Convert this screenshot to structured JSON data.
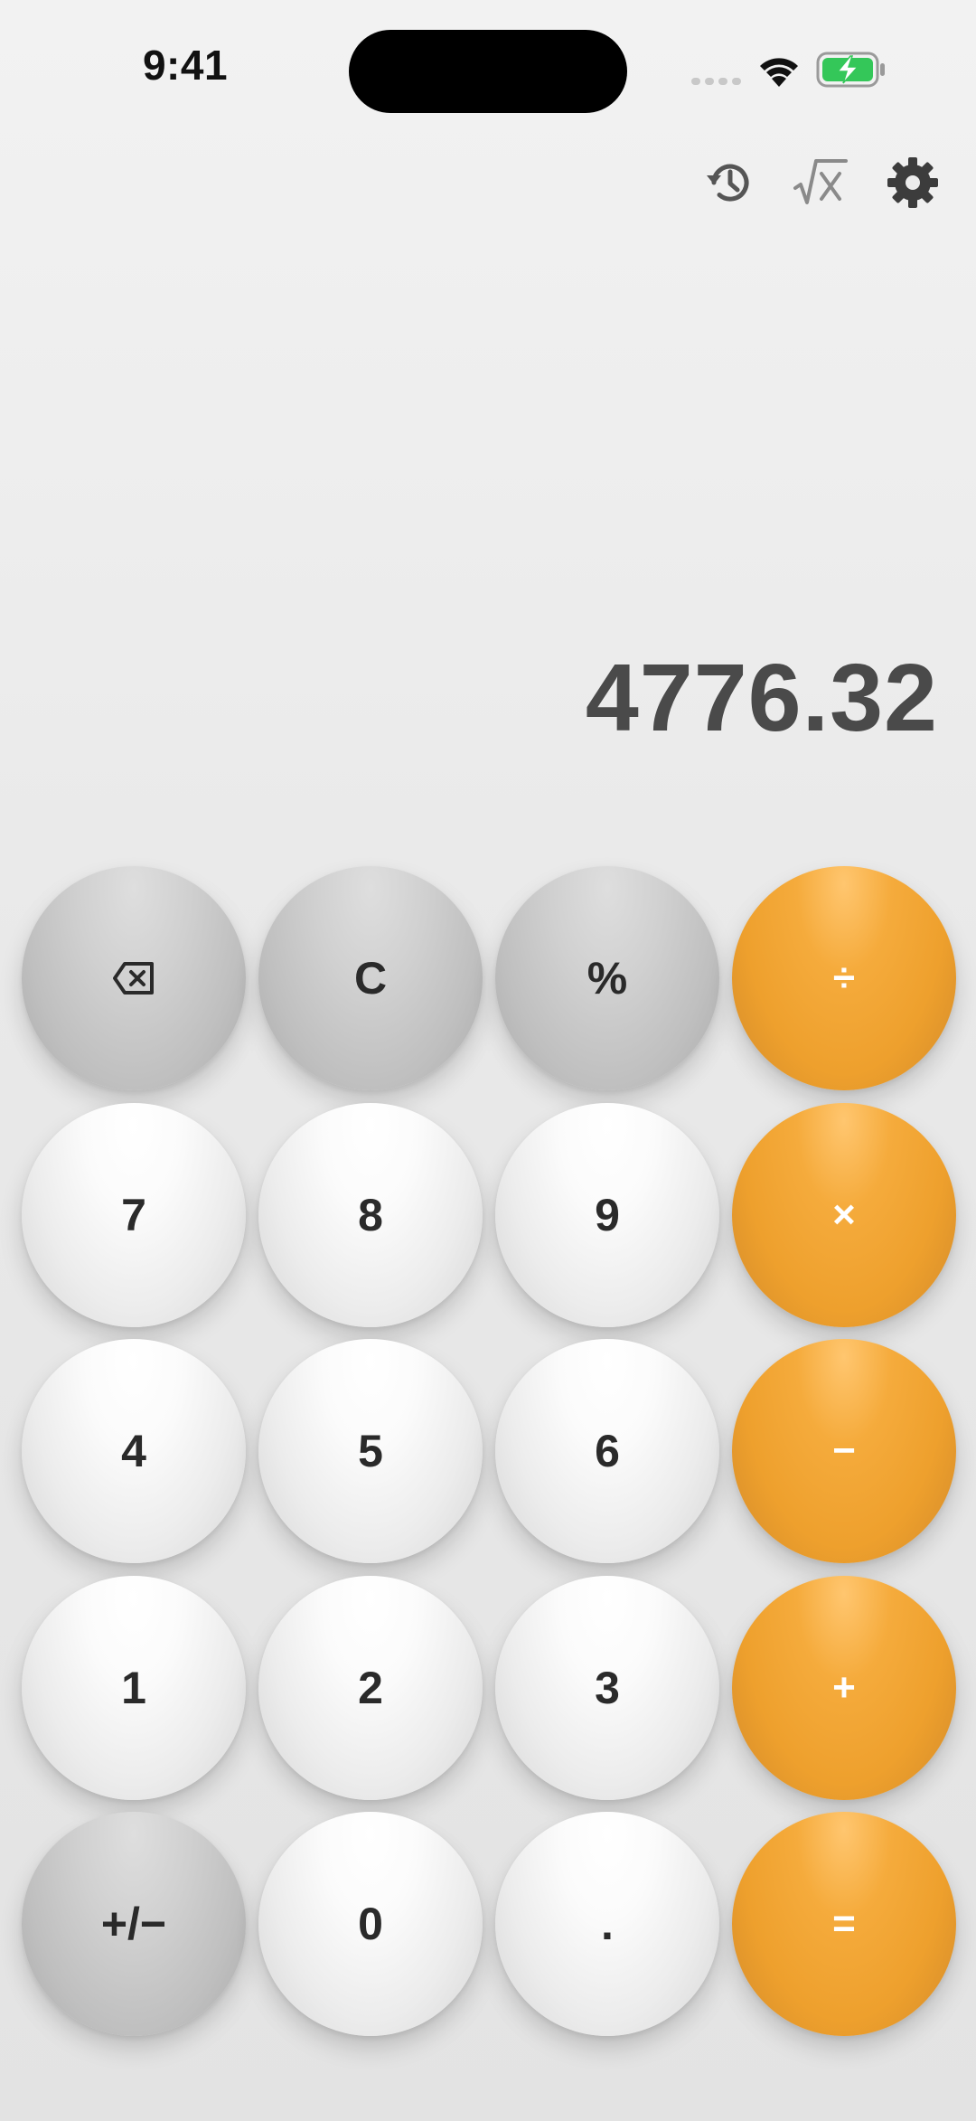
{
  "status_bar": {
    "time": "9:41",
    "icons": [
      "signal-icon",
      "wifi-icon",
      "battery-charging-icon"
    ],
    "battery_color": "#34c759"
  },
  "toolbar": {
    "icons": [
      "history-icon",
      "sqrt-icon",
      "gear-icon"
    ]
  },
  "display": {
    "value": "4776.32"
  },
  "keypad": {
    "colors": {
      "operator": "#f0a22e",
      "function": "#c4c4c4",
      "digit": "#f4f4f4",
      "label_dark": "#2a2a2a",
      "label_light": "#ffffff"
    },
    "keys": {
      "backspace": "backspace-icon",
      "clear": "C",
      "percent": "%",
      "divide": "÷",
      "seven": "7",
      "eight": "8",
      "nine": "9",
      "multiply": "×",
      "four": "4",
      "five": "5",
      "six": "6",
      "subtract": "−",
      "one": "1",
      "two": "2",
      "three": "3",
      "add": "+",
      "sign": "+/−",
      "zero": "0",
      "decimal": ".",
      "equals": "="
    }
  }
}
